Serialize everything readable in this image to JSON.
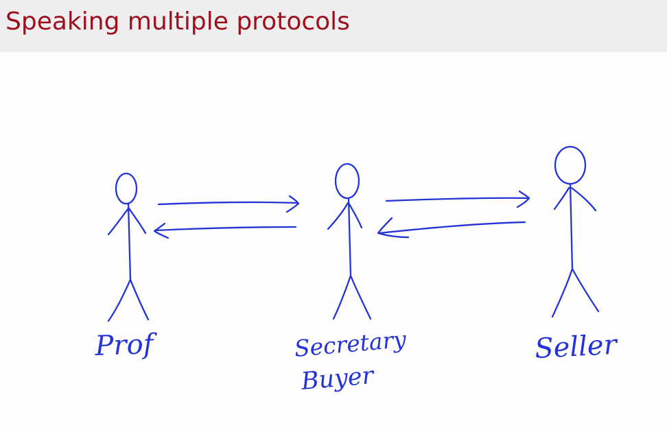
{
  "slide": {
    "title": "Speaking multiple protocols"
  },
  "diagram": {
    "ink_color": "#2433d6",
    "title_color": "#9e0f1e",
    "figures": [
      {
        "id": "prof",
        "label": "Prof"
      },
      {
        "id": "secretary-buyer",
        "label_lines": [
          "Secretary",
          "Buyer"
        ]
      },
      {
        "id": "seller",
        "label": "Seller"
      }
    ],
    "arrows": [
      {
        "from": "Prof",
        "to": "Secretary/Buyer"
      },
      {
        "from": "Secretary/Buyer",
        "to": "Prof"
      },
      {
        "from": "Secretary/Buyer",
        "to": "Seller"
      },
      {
        "from": "Seller",
        "to": "Secretary/Buyer"
      }
    ]
  }
}
